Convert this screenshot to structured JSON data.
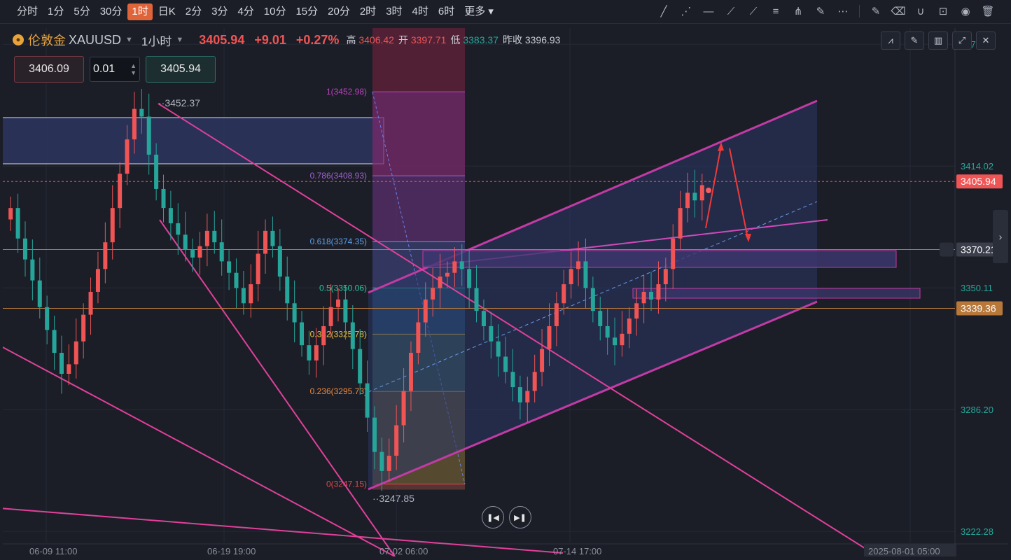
{
  "timeframes": [
    "分时",
    "1分",
    "5分",
    "30分",
    "1时",
    "日K",
    "2分",
    "3分",
    "4分",
    "10分",
    "15分",
    "20分",
    "2时",
    "3时",
    "4时",
    "6时",
    "更多"
  ],
  "active_timeframe": "1时",
  "toolbar_icons": [
    "trendline-icon",
    "ray-icon",
    "hline-icon",
    "polyline-icon",
    "segment-icon",
    "fib-icon",
    "fan-icon",
    "brush-icon",
    "more-icon",
    "edit-icon",
    "eraser-icon",
    "magnet-icon",
    "lock-icon",
    "eye-icon",
    "trash-icon"
  ],
  "header": {
    "symbol_cn": "伦敦金",
    "symbol": "XAUUSD",
    "period": "1小时",
    "price": "3405.94",
    "change": "+9.01",
    "change_pct": "+0.27%",
    "high_label": "高",
    "high": "3406.42",
    "open_label": "开",
    "open": "3397.71",
    "low_label": "低",
    "low": "3383.37",
    "prev_label": "昨收",
    "prev": "3396.93"
  },
  "order": {
    "sell": "3406.09",
    "qty": "0.01",
    "buy": "3405.94"
  },
  "colors": {
    "up": "#f05454",
    "down": "#26a69a",
    "bg": "#1b1e27",
    "channel": "#c23ba5",
    "fib_band": "#6b2c6b"
  },
  "chart_data": {
    "type": "candlestick",
    "x_ticks": [
      "06-09 11:00",
      "06-19 19:00",
      "07-02 06:00",
      "07-14 17:00",
      "2025-08-01 05:00"
    ],
    "y_ticks": [
      "3477.93",
      "3414.02",
      "3350.11",
      "3286.20",
      "3222.28"
    ],
    "y_range": [
      3215,
      3485
    ],
    "price_labels": [
      {
        "value": 3405.94,
        "text": "3405.94",
        "color": "#f05454"
      },
      {
        "value": 3370.21,
        "text": "3370.21",
        "color": "#3a3f4b"
      },
      {
        "value": 3339.36,
        "text": "3339.36",
        "color": "#b8783a"
      }
    ],
    "annotations": {
      "high": "3452.37",
      "low": "3247.85"
    },
    "fib_levels": [
      {
        "ratio": "1",
        "price": 3452.98,
        "label": "1(3452.98)",
        "color": "#c040c0"
      },
      {
        "ratio": "0.786",
        "price": 3408.93,
        "label": "0.786(3408.93)",
        "color": "#a060d0"
      },
      {
        "ratio": "0.618",
        "price": 3374.35,
        "label": "0.618(3374.35)",
        "color": "#5aa0e8"
      },
      {
        "ratio": "0.5",
        "price": 3350.06,
        "label": "0.5(3350.06)",
        "color": "#26c6a0"
      },
      {
        "ratio": "0.382",
        "price": 3325.78,
        "label": "0.382(3325.78)",
        "color": "#e8c040"
      },
      {
        "ratio": "0.236",
        "price": 3295.73,
        "label": "0.236(3295.73)",
        "color": "#f08a40"
      },
      {
        "ratio": "0",
        "price": 3247.15,
        "label": "0(3247.15)",
        "color": "#e04848"
      }
    ],
    "closes": [
      3392,
      3376,
      3365,
      3354,
      3340,
      3328,
      3316,
      3305,
      3310,
      3322,
      3336,
      3348,
      3360,
      3374,
      3392,
      3410,
      3428,
      3444,
      3440,
      3420,
      3402,
      3392,
      3384,
      3378,
      3370,
      3366,
      3372,
      3380,
      3374,
      3364,
      3358,
      3350,
      3342,
      3352,
      3368,
      3380,
      3372,
      3356,
      3342,
      3332,
      3320,
      3312,
      3320,
      3330,
      3340,
      3344,
      3332,
      3318,
      3300,
      3282,
      3264,
      3254,
      3262,
      3278,
      3296,
      3316,
      3332,
      3344,
      3350,
      3356,
      3358,
      3364,
      3360,
      3350,
      3338,
      3330,
      3322,
      3314,
      3306,
      3298,
      3290,
      3296,
      3306,
      3318,
      3330,
      3342,
      3352,
      3360,
      3364,
      3350,
      3338,
      3330,
      3324,
      3320,
      3326,
      3334,
      3342,
      3348,
      3344,
      3352,
      3360,
      3376,
      3392,
      3400,
      3396,
      3404
    ]
  }
}
